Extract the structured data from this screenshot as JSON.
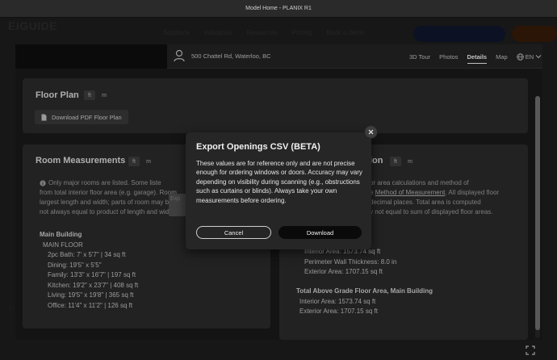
{
  "window": {
    "title": "Model Home - PLANIX R1"
  },
  "background_site": {
    "logo": "EIGUIDE",
    "nav": [
      "Solutions",
      "Industries",
      "Resources",
      "Pricing",
      "Book a demo"
    ],
    "left_letters": [
      "D"
    ]
  },
  "viewer": {
    "address": "500 Chattel Rd, Waterloo, BC",
    "tabs": [
      {
        "label": "3D Tour",
        "active": false
      },
      {
        "label": "Photos",
        "active": false
      },
      {
        "label": "Details",
        "active": true
      },
      {
        "label": "Map",
        "active": false
      }
    ],
    "language": "EN",
    "tooltip_fragment": "Exp",
    "floor_plan": {
      "title": "Floor Plan",
      "unit_ft": "ft",
      "unit_m": "m",
      "download_label": "Download PDF Floor Plan"
    },
    "room_measurements": {
      "title": "Room Measurements",
      "unit_ft": "ft",
      "unit_m": "m",
      "info_lines": [
        "Only major rooms are listed. Some liste",
        "from total interior floor area (e.g. garage). Room",
        "largest length and width; parts of room may be",
        "not always equal to product of length and width"
      ],
      "building": "Main Building",
      "floor": "MAIN FLOOR",
      "rooms": [
        "2pc Bath: 7' x 5'7\"  |  34 sq ft",
        "Dining: 19'5\" x 5'5\"",
        "Family: 13'3\" x 16'7\"  |  197 sq ft",
        "Kitchen: 19'2\" x 23'7\"  |  408 sq ft",
        "Living: 19'5\" x 19'8\"  |  365 sq ft",
        "Office: 11'4\" x 11'2\"  |  126 sq ft"
      ]
    },
    "floor_area": {
      "title_fragment": "ion",
      "unit_ft": "ft",
      "unit_m": "m",
      "info_lines": [
        "or area calculations and method of",
        "e Method of Measurement. All displayed floor",
        "decimal places. Total area is computed",
        "y not equal to sum of displayed floor areas."
      ],
      "link_text": "Method of Measurement",
      "interior_area": "Interior Area: 1573.74 sq ft",
      "perimeter_wall": "Perimeter Wall Thickness: 8.0 in",
      "exterior_area": "Exterior Area: 1707.15 sq ft",
      "total_title": "Total Above Grade Floor Area, Main Building",
      "total_interior": "Interior Area: 1573.74 sq ft",
      "total_exterior": "Exterior Area: 1707.15 sq ft"
    }
  },
  "modal": {
    "title": "Export Openings CSV (BETA)",
    "body": "These values are for reference only and are not precise enough for ordering windows or doors. Accuracy may vary depending on visibility during scanning (e.g., obstructions such as curtains or blinds). Always take your own measurements before ordering.",
    "cancel_label": "Cancel",
    "download_label": "Download"
  }
}
